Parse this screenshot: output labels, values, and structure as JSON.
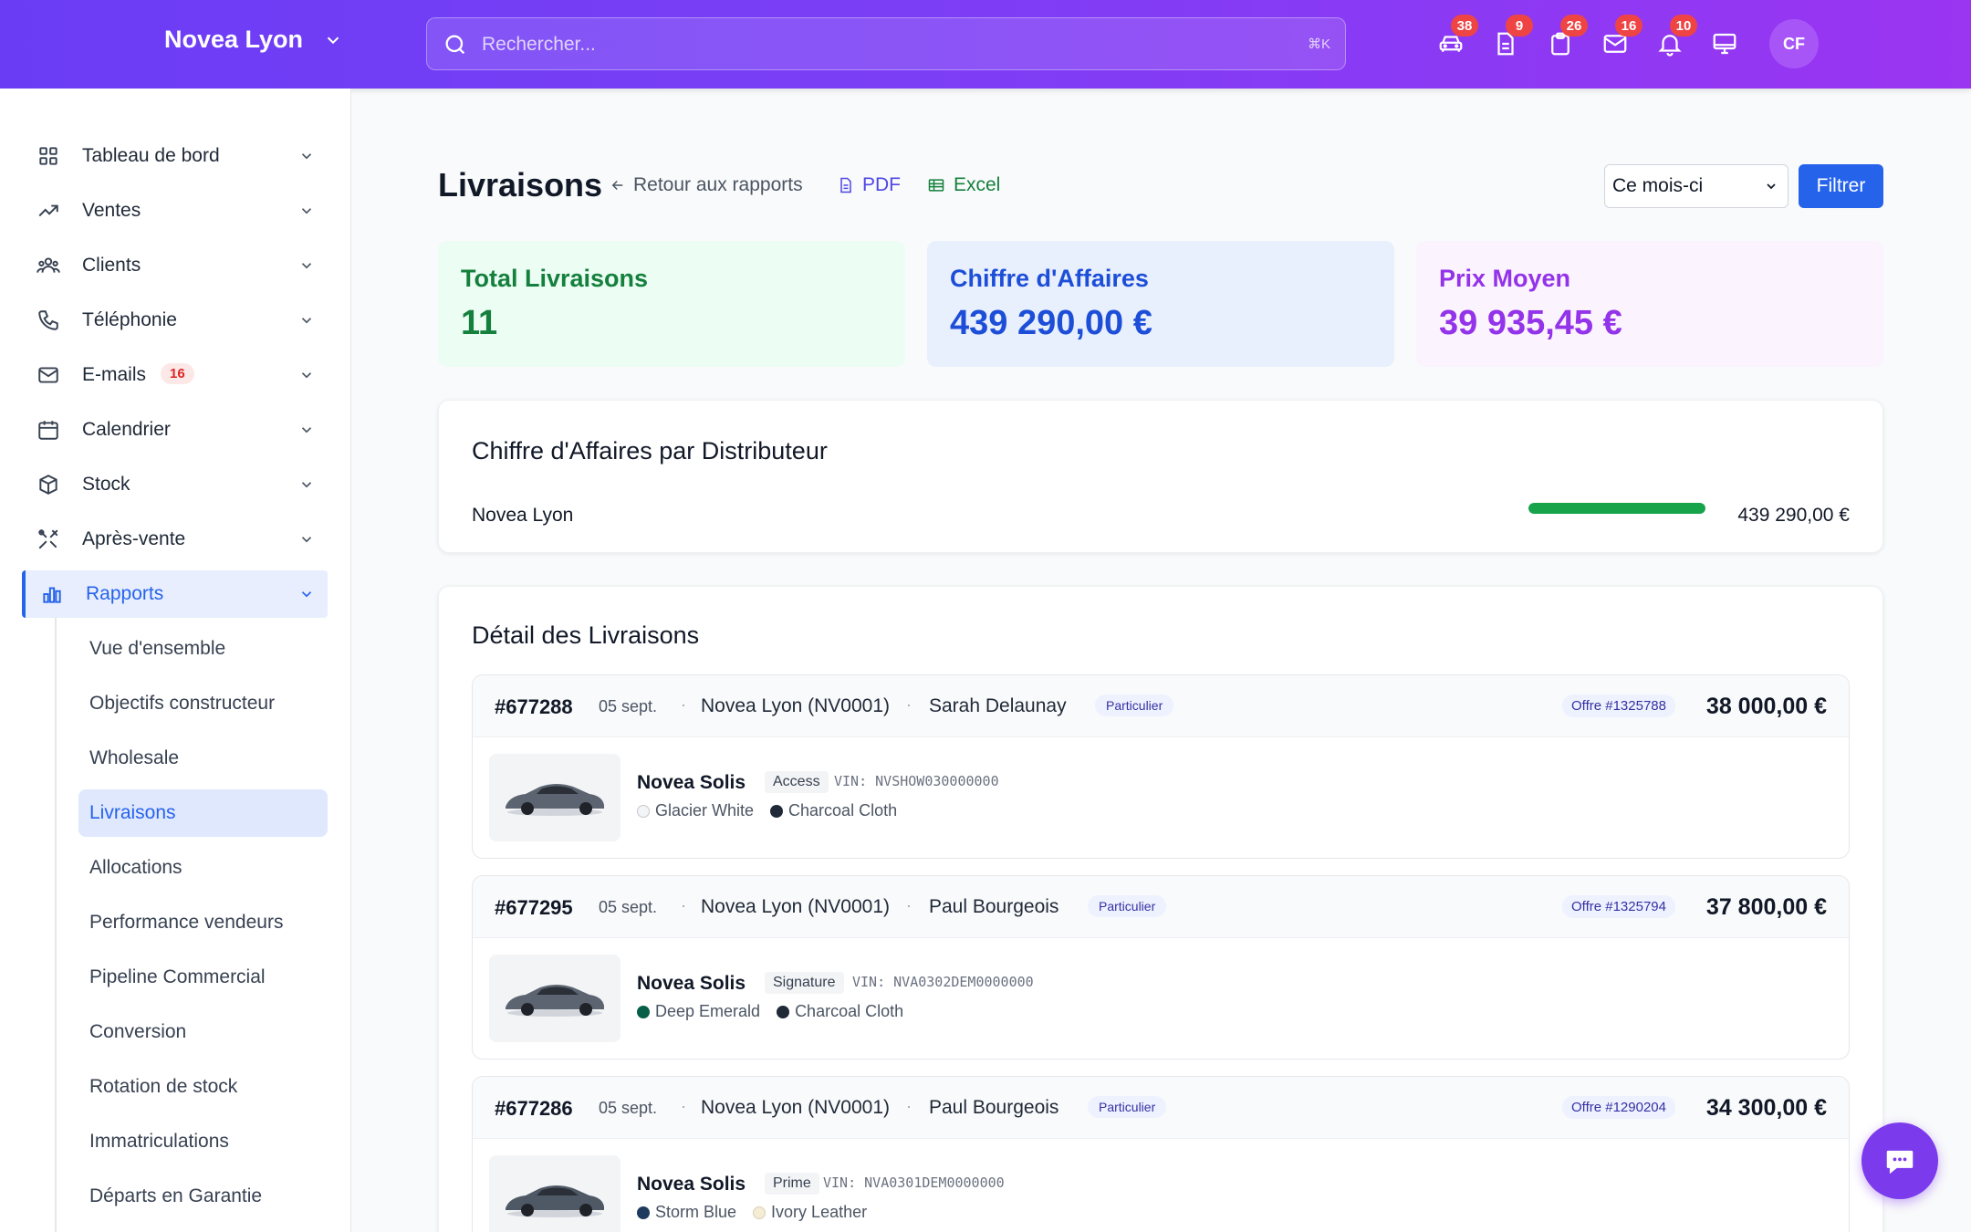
{
  "header": {
    "brand": "Novea Lyon",
    "search_placeholder": "Rechercher...",
    "search_shortcut": "⌘K",
    "icons": [
      {
        "name": "car-icon",
        "badge": "38"
      },
      {
        "name": "document-icon",
        "badge": "9"
      },
      {
        "name": "clipboard-icon",
        "badge": "26"
      },
      {
        "name": "mail-icon",
        "badge": "16"
      },
      {
        "name": "bell-icon",
        "badge": "10"
      },
      {
        "name": "monitor-icon",
        "badge": ""
      }
    ],
    "avatar": "CF"
  },
  "sidebar": {
    "items": [
      {
        "label": "Tableau de bord",
        "icon": "grid-icon"
      },
      {
        "label": "Ventes",
        "icon": "trending-up-icon"
      },
      {
        "label": "Clients",
        "icon": "users-icon"
      },
      {
        "label": "Téléphonie",
        "icon": "phone-icon"
      },
      {
        "label": "E-mails",
        "icon": "mail-icon",
        "badge": "16"
      },
      {
        "label": "Calendrier",
        "icon": "calendar-icon"
      },
      {
        "label": "Stock",
        "icon": "box-icon"
      },
      {
        "label": "Après-vente",
        "icon": "tools-icon"
      },
      {
        "label": "Rapports",
        "icon": "bar-chart-icon"
      }
    ],
    "sub_items": [
      "Vue d'ensemble",
      "Objectifs constructeur",
      "Wholesale",
      "Livraisons",
      "Allocations",
      "Performance vendeurs",
      "Pipeline Commercial",
      "Conversion",
      "Rotation de stock",
      "Immatriculations",
      "Départs en Garantie"
    ]
  },
  "page": {
    "title": "Livraisons",
    "back_link": "Retour aux rapports",
    "pdf": "PDF",
    "excel": "Excel",
    "period": "Ce mois-ci",
    "filter": "Filtrer"
  },
  "stats": [
    {
      "title": "Total Livraisons",
      "value": "11",
      "color": "#15803d",
      "bg": "#ecfdf3"
    },
    {
      "title": "Chiffre d'Affaires",
      "value": "439 290,00 €",
      "color": "#1d4ed8",
      "bg": "#e8effd"
    },
    {
      "title": "Prix Moyen",
      "value": "39 935,45 €",
      "color": "#9333ea",
      "bg": "#fbf3fe"
    }
  ],
  "distributors": {
    "title": "Chiffre d'Affaires par Distributeur",
    "rows": [
      {
        "name": "Novea Lyon",
        "share": 1.0,
        "value": "439 290,00 €"
      }
    ]
  },
  "deliveries": {
    "title": "Détail des Livraisons",
    "items": [
      {
        "id": "#677288",
        "date": "05 sept.",
        "distributor": "Novea Lyon (NV0001)",
        "client": "Sarah Delaunay",
        "type": "Particulier",
        "offer": "Offre #1325788",
        "price": "38 000,00 €",
        "model": "Novea Solis",
        "trim": "Access",
        "vin": "VIN: NVSHOW030000000",
        "ext": "Glacier White",
        "ext_color": "#f3f4f6",
        "int": "Charcoal Cloth",
        "int_color": "#1f2937"
      },
      {
        "id": "#677295",
        "date": "05 sept.",
        "distributor": "Novea Lyon (NV0001)",
        "client": "Paul Bourgeois",
        "type": "Particulier",
        "offer": "Offre #1325794",
        "price": "37 800,00 €",
        "model": "Novea Solis",
        "trim": "Signature",
        "vin": "VIN: NVA0302DEM0000000",
        "ext": "Deep Emerald",
        "ext_color": "#065f46",
        "int": "Charcoal Cloth",
        "int_color": "#1f2937"
      },
      {
        "id": "#677286",
        "date": "05 sept.",
        "distributor": "Novea Lyon (NV0001)",
        "client": "Paul Bourgeois",
        "type": "Particulier",
        "offer": "Offre #1290204",
        "price": "34 300,00 €",
        "model": "Novea Solis",
        "trim": "Prime",
        "vin": "VIN: NVA0301DEM0000000",
        "ext": "Storm Blue",
        "ext_color": "#1e3a5f",
        "int": "Ivory Leather",
        "int_color": "#f5ecd6"
      }
    ]
  }
}
